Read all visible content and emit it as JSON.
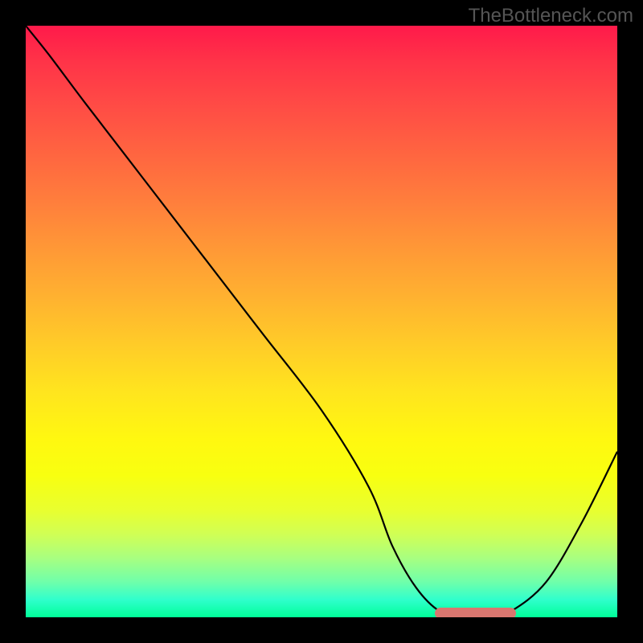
{
  "watermark": "TheBottleneck.com",
  "colors": {
    "background": "#000000",
    "gradient_top": "#ff1a4a",
    "gradient_bottom": "#00ff99",
    "curve": "#000000",
    "marker": "#d9766f"
  },
  "chart_data": {
    "type": "line",
    "title": "",
    "xlabel": "",
    "ylabel": "",
    "xlim": [
      0,
      100
    ],
    "ylim": [
      0,
      100
    ],
    "series": [
      {
        "name": "bottleneck-curve",
        "x": [
          0,
          4,
          10,
          20,
          30,
          40,
          50,
          58,
          62,
          66,
          70,
          74,
          78,
          82,
          88,
          94,
          100
        ],
        "values": [
          100,
          95,
          87,
          74,
          61,
          48,
          35,
          22,
          12,
          5,
          1,
          0,
          0,
          1,
          6,
          16,
          28
        ]
      }
    ],
    "annotations": [
      {
        "name": "optimal-flat",
        "x_start": 70,
        "x_end": 82,
        "y": 0
      }
    ]
  }
}
